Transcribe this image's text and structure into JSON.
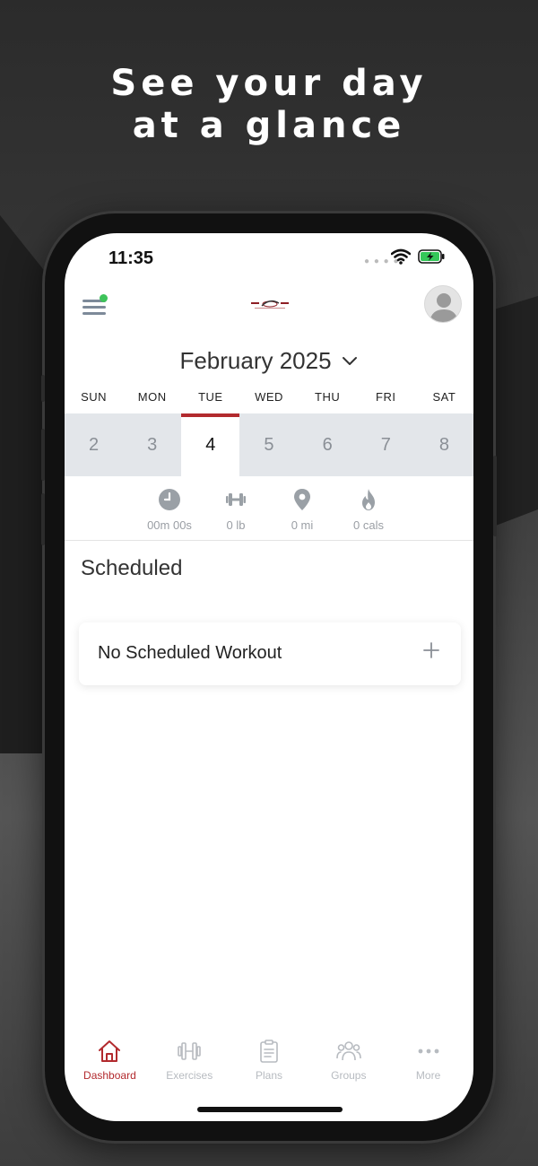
{
  "headline": {
    "line1": "See your day",
    "line2": "at a glance"
  },
  "status_bar": {
    "time": "11:35",
    "signal_icon": "signal-dots-icon",
    "wifi_icon": "wifi-icon",
    "battery_icon": "battery-charging-icon"
  },
  "header": {
    "menu_icon": "hamburger-menu-icon",
    "logo_icon": "agewell-logo-icon",
    "avatar_icon": "user-avatar-icon"
  },
  "calendar": {
    "month_label": "February 2025",
    "weekdays": [
      "SUN",
      "MON",
      "TUE",
      "WED",
      "THU",
      "FRI",
      "SAT"
    ],
    "dates": [
      "2",
      "3",
      "4",
      "5",
      "6",
      "7",
      "8"
    ],
    "selected_index": 2
  },
  "stats": [
    {
      "icon": "clock-icon",
      "value": "00m 00s"
    },
    {
      "icon": "dumbbell-icon",
      "value": "0 lb"
    },
    {
      "icon": "location-pin-icon",
      "value": "0 mi"
    },
    {
      "icon": "flame-icon",
      "value": "0 cals"
    }
  ],
  "scheduled": {
    "title": "Scheduled",
    "empty_label": "No Scheduled Workout",
    "add_icon": "plus-icon"
  },
  "tabs": [
    {
      "label": "Dashboard",
      "icon": "home-icon"
    },
    {
      "label": "Exercises",
      "icon": "dumbbell-icon"
    },
    {
      "label": "Plans",
      "icon": "clipboard-icon"
    },
    {
      "label": "Groups",
      "icon": "group-icon"
    },
    {
      "label": "More",
      "icon": "more-dots-icon"
    }
  ],
  "colors": {
    "accent": "#b22a2e",
    "online_dot": "#3ec35a",
    "date_strip": "#e3e6ea",
    "inactive": "#b7bbc0"
  }
}
